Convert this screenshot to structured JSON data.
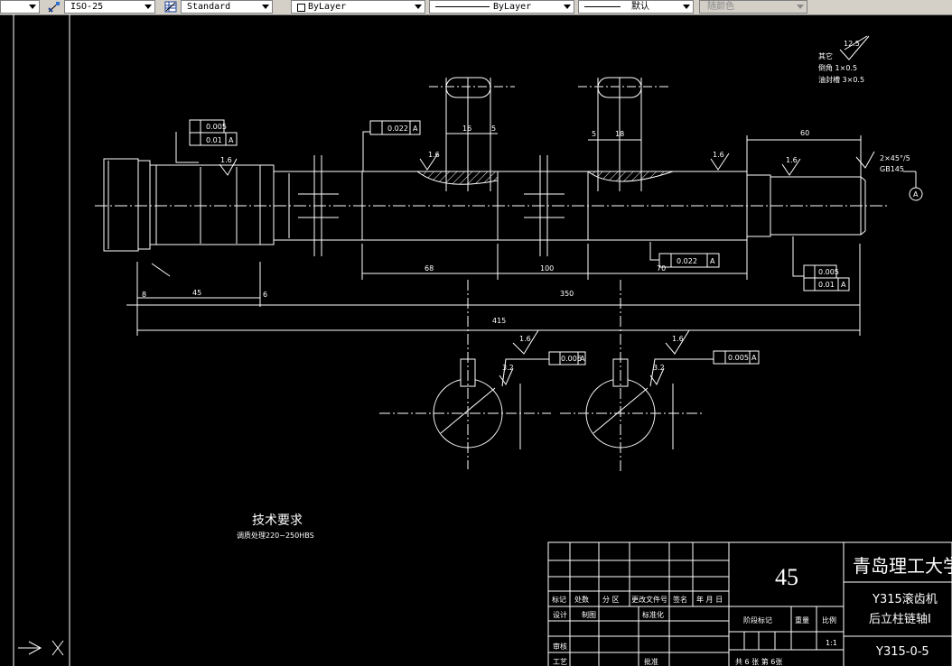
{
  "toolbar": {
    "dimstyle_value": "ISO-25",
    "tablestyle_value": "Standard",
    "color_value": "ByLayer",
    "linetype_value": "ByLayer",
    "lineweight_value": "默认",
    "plotstyle_value": "随颜色"
  },
  "drawing": {
    "colors": {
      "background": "#000000",
      "lines": "#ffffff",
      "toolbar": "#d4d0c8"
    },
    "roughness_note": {
      "value": "12.5",
      "line1": "其它",
      "line2": "倒角 1×0.5",
      "line3": "油封槽 3×0.5"
    },
    "tolerances": {
      "runout_left_top": "0.005",
      "runout_left_bottom": "0.01",
      "runout_left_datum": "A",
      "runout_mid": "0.022",
      "runout_mid_datum": "A",
      "runout_right_bottom": "0.022",
      "runout_right_bottom_datum": "A",
      "runout_right_a": "0.005",
      "runout_right_b": "0.01",
      "runout_right_b_datum": "A",
      "sym_left": "0.006",
      "sym_left_datum": "A",
      "sym_right": "0.005",
      "sym_right_datum": "A"
    },
    "roughness": {
      "r1": "1.6",
      "r2": "1.6",
      "r3": "1.6",
      "r4": "1.6",
      "r5": "1.6",
      "r6": "3.2",
      "r7": "1.6",
      "r8": "3.2"
    },
    "dims": {
      "key1_width": "16",
      "key1_gap": "5",
      "key2_gap": "5",
      "key2_width": "18",
      "end_len": "60",
      "len_68": "68",
      "len_100": "100",
      "len_70": "70",
      "len_8": "8",
      "len_45": "45",
      "len_6": "6",
      "len_350": "350",
      "len_total": "415",
      "datum_a": "A",
      "chamfer_note": "2×45°/5",
      "note_gb": "GB145"
    },
    "tech_title": "技术要求",
    "tech_text": "调质处理220~250HBS"
  },
  "title_block": {
    "material": "45",
    "school": "青岛理工大学",
    "part_line1": "Y315滚齿机",
    "part_line2": "后立柱链轴I",
    "drawing_no": "Y315-0-5",
    "scale": "1:1",
    "sheet_info": "共 6 张  第 6张",
    "h_mark": "标记",
    "h_count": "处数",
    "h_zone": "分 区",
    "h_docno": "更改文件号",
    "h_sign": "签名",
    "h_date": "年 月 日",
    "h_design": "设计",
    "h_drawn": "制图",
    "h_std": "标准化",
    "h_check": "审核",
    "h_process": "工艺",
    "h_approve": "批准",
    "h_stage": "阶段标记",
    "h_weight": "重量",
    "h_ratio": "比例"
  }
}
